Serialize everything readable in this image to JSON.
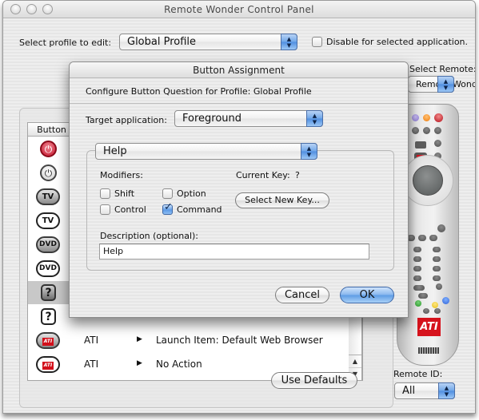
{
  "window": {
    "title": "Remote Wonder Control Panel"
  },
  "main": {
    "profile_label": "Select profile to edit:",
    "profile_value": "Global Profile",
    "disable_label": "Disable for selected application.",
    "disable_checked": false,
    "select_remote_label": "Select Remote:",
    "select_remote_value": "Remote Wonder II",
    "list": {
      "column_header": "Button",
      "rows": [
        {
          "icon": "power-red",
          "name": "",
          "action": "",
          "selected": false
        },
        {
          "icon": "power-white",
          "name": "",
          "action": "",
          "selected": false
        },
        {
          "icon": "tv-filled",
          "name": "",
          "action": "",
          "selected": false
        },
        {
          "icon": "tv-outline",
          "name": "",
          "action": "",
          "selected": false
        },
        {
          "icon": "dvd-filled",
          "name": "",
          "action": "",
          "selected": false
        },
        {
          "icon": "dvd-outline",
          "name": "",
          "action": "",
          "selected": false
        },
        {
          "icon": "question-filled",
          "name": "",
          "action": "",
          "selected": true
        },
        {
          "icon": "question-outline",
          "name": "",
          "action": "",
          "selected": false
        },
        {
          "icon": "ati-filled",
          "name": "ATI",
          "action": "Launch Item: Default Web Browser",
          "selected": false
        },
        {
          "icon": "ati-outline",
          "name": "ATI",
          "action": "No Action",
          "selected": false
        }
      ],
      "icon_text": {
        "tv": "TV",
        "dvd": "DVD",
        "question": "?",
        "ati": "ATI",
        "power": "⏻"
      }
    },
    "use_defaults_label": "Use Defaults",
    "remote_id_label": "Remote ID:",
    "remote_id_value": "All",
    "remote_logo": "ATI"
  },
  "dialog": {
    "title": "Button Assignment",
    "subheader": "Configure Button Question for Profile: Global Profile",
    "target_label": "Target application:",
    "target_value": "Foreground",
    "action_value": "Help",
    "modifiers_label": "Modifiers:",
    "modifiers": {
      "shift": {
        "label": "Shift",
        "checked": false
      },
      "option": {
        "label": "Option",
        "checked": false
      },
      "control": {
        "label": "Control",
        "checked": false
      },
      "command": {
        "label": "Command",
        "checked": true
      }
    },
    "current_key_label": "Current Key:",
    "current_key_value": "?",
    "select_key_label": "Select New Key...",
    "description_label": "Description (optional):",
    "description_value": "Help",
    "cancel_label": "Cancel",
    "ok_label": "OK"
  },
  "icons": {
    "popup_arrows": "▲▼",
    "checkmark": "✓",
    "disclosure": "▶",
    "scroll_up": "▲",
    "scroll_down": "▼"
  },
  "colors": {
    "accent_blue": "#5c9be5",
    "ati_red": "#d6131d",
    "selection_gray": "#c8c8c8"
  }
}
